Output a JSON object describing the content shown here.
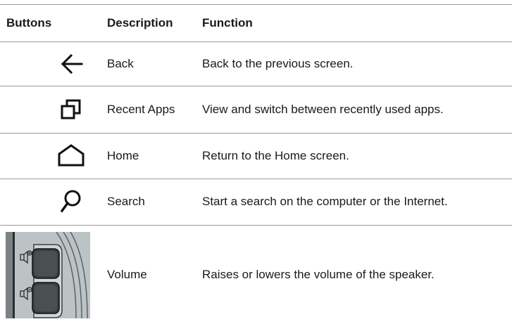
{
  "header": {
    "buttons": "Buttons",
    "description": "Description",
    "function": "Function"
  },
  "rows": [
    {
      "icon": "back-arrow-icon",
      "description": "Back",
      "function": "Back to the previous screen."
    },
    {
      "icon": "recent-apps-icon",
      "description": "Recent Apps",
      "function": "View and switch between recently used apps."
    },
    {
      "icon": "home-icon",
      "description": "Home",
      "function": "Return to the Home screen."
    },
    {
      "icon": "search-icon",
      "description": "Search",
      "function": "Start a search on the computer or the Internet."
    },
    {
      "icon": "volume-buttons-image",
      "description": "Volume",
      "function": "Raises or lowers the volume of the speaker."
    }
  ],
  "colors": {
    "rule": "#9a9a9a",
    "text": "#1a1a1a",
    "icon": "#111111"
  }
}
